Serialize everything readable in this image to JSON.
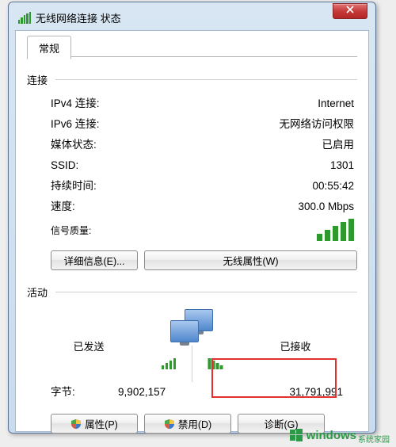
{
  "window": {
    "title": "无线网络连接 状态"
  },
  "tab": {
    "label": "常规"
  },
  "conn": {
    "section": "连接",
    "ipv4_label": "IPv4 连接:",
    "ipv4_value": "Internet",
    "ipv6_label": "IPv6 连接:",
    "ipv6_value": "无网络访问权限",
    "media_label": "媒体状态:",
    "media_value": "已启用",
    "ssid_label": "SSID:",
    "ssid_value": "1301",
    "duration_label": "持续时间:",
    "duration_value": "00:55:42",
    "speed_label": "速度:",
    "speed_value": "300.0 Mbps",
    "signal_label": "信号质量:"
  },
  "buttons": {
    "details": "详细信息(E)...",
    "wireless_props": "无线属性(W)",
    "properties": "属性(P)",
    "disable": "禁用(D)",
    "diagnose": "诊断(G)"
  },
  "activity": {
    "section": "活动",
    "sent": "已发送",
    "recv": "已接收",
    "bytes_label": "字节:",
    "sent_val": "9,902,157",
    "recv_val": "31,791,991"
  },
  "watermark": {
    "text": "windows",
    "sub": "系统家园"
  }
}
